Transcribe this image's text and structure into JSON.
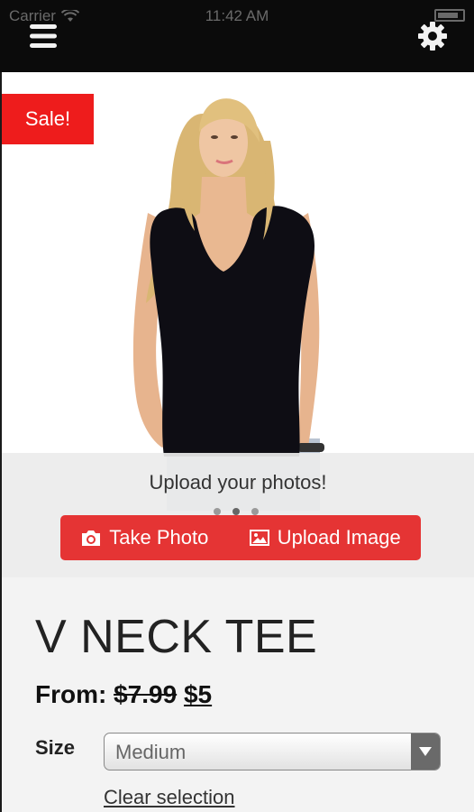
{
  "status_bar": {
    "carrier": "Carrier",
    "time": "11:42 AM"
  },
  "header": {
    "menu_icon": "hamburger-menu-icon",
    "settings_icon": "gear-icon"
  },
  "badge": {
    "label": "Sale!"
  },
  "upload": {
    "title": "Upload your photos!",
    "take_photo_label": "Take Photo",
    "upload_image_label": "Upload Image",
    "page_dots": 3,
    "active_dot": 2
  },
  "product": {
    "title": "V NECK TEE",
    "price_prefix": "From:",
    "price_old": "$7.99",
    "price_new": "$5",
    "size_label": "Size",
    "size_value": "Medium",
    "clear_label": "Clear selection"
  },
  "colors": {
    "accent": "#e53434",
    "badge": "#ee1c1c",
    "topbar": "#0b0b0b"
  }
}
